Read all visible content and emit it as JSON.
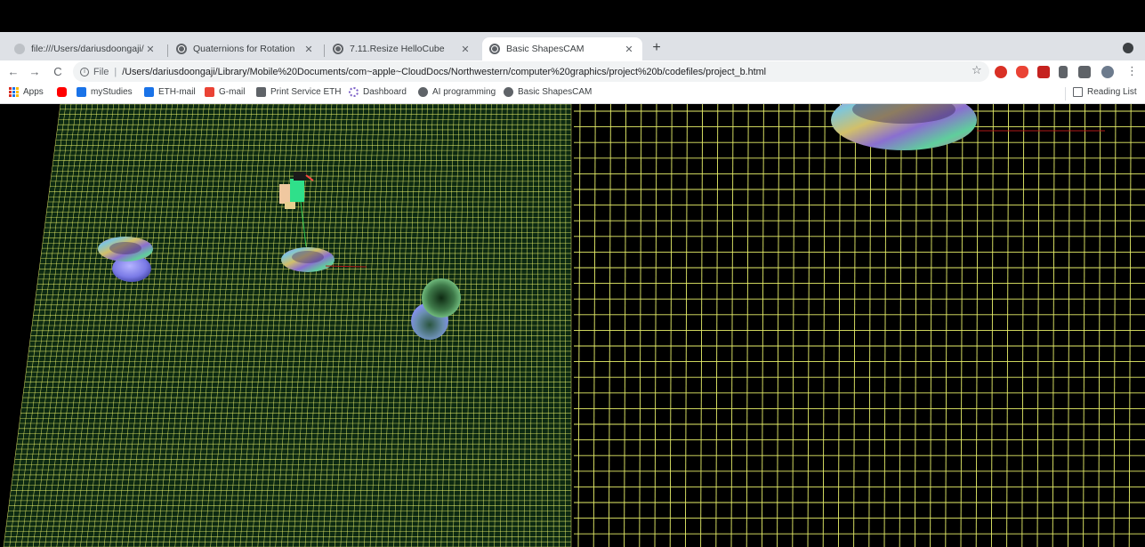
{
  "tabs": [
    {
      "title": "file:///Users/dariusdoongaji/Libr",
      "favicon": "file-icon",
      "active": false
    },
    {
      "title": "Quaternions for Rotation",
      "favicon": "globe-icon",
      "active": false
    },
    {
      "title": "7.11.Resize HelloCube",
      "favicon": "globe-icon",
      "active": false
    },
    {
      "title": "Basic ShapesCAM",
      "favicon": "globe-icon",
      "active": true
    }
  ],
  "tab_close": "✕",
  "new_tab": "+",
  "toolbar": {
    "back": "←",
    "forward": "→",
    "reload": "C",
    "scheme_label": "File",
    "url": "/Users/dariusdoongaji/Library/Mobile%20Documents/com~apple~CloudDocs/Northwestern/computer%20graphics/project%20b/codefiles/project_b.html",
    "star": "☆",
    "menu": "⋮"
  },
  "bookmarks": {
    "apps": "Apps",
    "items": [
      "myStudies",
      "ETH-mail",
      "G-mail",
      "Print Service ETH",
      "Dashboard",
      "AI programming",
      "Basic ShapesCAM"
    ],
    "reading_list": "Reading List"
  },
  "colors": {
    "grid_line": "#e8f06a",
    "grid_bg_left": "#0d2a12",
    "grid_bg_right": "#000000",
    "tab_strip": "#dee1e6"
  }
}
